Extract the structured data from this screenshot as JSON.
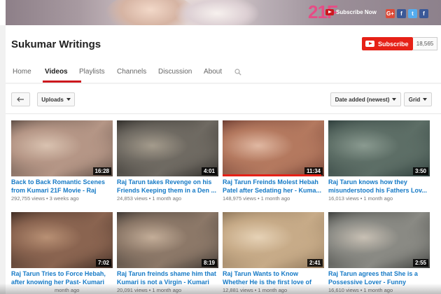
{
  "banner": {
    "logo_text": "21F",
    "subscribe_now": "Subscribe Now",
    "social": [
      "G+",
      "f",
      "t",
      "f"
    ]
  },
  "channel": {
    "title": "Sukumar Writings",
    "subscribe_label": "Subscribe",
    "subscriber_count": "18,565"
  },
  "tabs": [
    {
      "label": "Home",
      "active": false
    },
    {
      "label": "Videos",
      "active": true
    },
    {
      "label": "Playlists",
      "active": false
    },
    {
      "label": "Channels",
      "active": false
    },
    {
      "label": "Discussion",
      "active": false
    },
    {
      "label": "About",
      "active": false
    }
  ],
  "toolbar": {
    "back_icon": "back-arrow-icon",
    "uploads_label": "Uploads",
    "sort_label": "Date added (newest)",
    "view_label": "Grid"
  },
  "videos": [
    {
      "title": "Back to Back Romantic Scenes from Kumari 21F Movie - Raj",
      "views": "292,755 views",
      "age": "3 weeks ago",
      "duration": "16:28",
      "progress": 0,
      "colors": [
        "#5a4a42",
        "#b59686",
        "#d9c2b0"
      ]
    },
    {
      "title": "Raj Tarun takes Revenge on his Friends Keeping them in a Den ...",
      "views": "24,853 views",
      "age": "1 month ago",
      "duration": "4:01",
      "progress": 0,
      "colors": [
        "#2c2a27",
        "#6f6a62",
        "#a49b8c"
      ]
    },
    {
      "title": "Raj Tarun Freinds Molest Hebah Patel after Sedating her - Kuma...",
      "views": "148,975 views",
      "age": "1 month ago",
      "duration": "11:34",
      "progress": 0.97,
      "colors": [
        "#6b3b30",
        "#b4795f",
        "#e0b8a2"
      ]
    },
    {
      "title": "Raj Tarun knows how they misunderstood his Fathers Lov...",
      "views": "16,013 views",
      "age": "1 month ago",
      "duration": "3:50",
      "progress": 0,
      "colors": [
        "#2c3c3a",
        "#5d6e66",
        "#8a9a90"
      ]
    },
    {
      "title": "Raj Tarun Tries to Force Hebah, after knowing her Past- Kumari",
      "views": "",
      "age": "month ago",
      "duration": "7:02",
      "progress": 0,
      "colors": [
        "#3c2a22",
        "#8a6450",
        "#b89074"
      ]
    },
    {
      "title": "Raj Tarun freinds shame him that Kumari is not a Virgin - Kumari",
      "views": "20,091 views",
      "age": "1 month ago",
      "duration": "8:19",
      "progress": 0,
      "colors": [
        "#3a3430",
        "#8c7868",
        "#c3ad98"
      ]
    },
    {
      "title": "Raj Tarun Wants to Know Whether He is the first love of",
      "views": "12,881 views",
      "age": "1 month ago",
      "duration": "2:41",
      "progress": 0,
      "colors": [
        "#8c7458",
        "#c7ab88",
        "#e6d2b6"
      ]
    },
    {
      "title": "Raj Tarun agrees that She is a Possessive Lover - Funny",
      "views": "16,610 views",
      "age": "1 month ago",
      "duration": "2:55",
      "progress": 0,
      "colors": [
        "#3a3c3a",
        "#8a8a84",
        "#c8c0b4"
      ]
    }
  ]
}
